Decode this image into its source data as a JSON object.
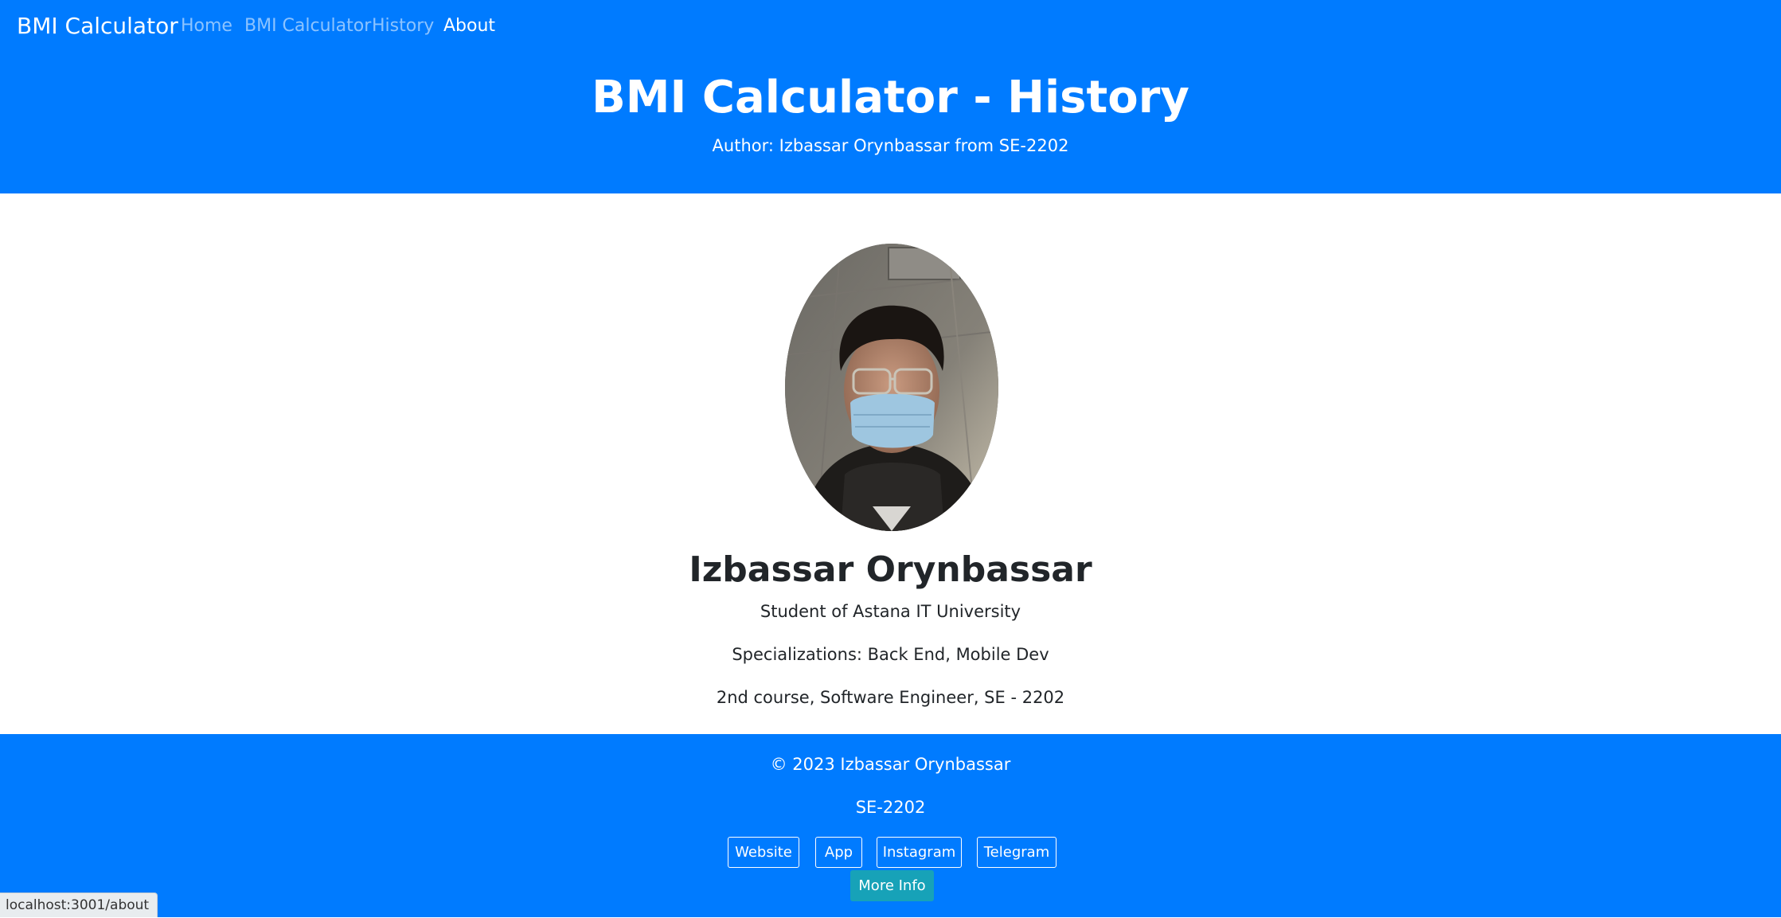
{
  "navbar": {
    "brand": "BMI Calculator",
    "links": [
      {
        "label": "Home",
        "active": false
      },
      {
        "label": "BMI Calculator",
        "active": false
      },
      {
        "label": "History",
        "active": false
      },
      {
        "label": "About",
        "active": true
      }
    ]
  },
  "hero": {
    "title": "BMI Calculator - History",
    "subtitle": "Author: Izbassar Orynbassar from SE-2202"
  },
  "profile": {
    "name": "Izbassar Orynbassar",
    "lines": [
      "Student of Astana IT University",
      "Specializations: Back End, Mobile Dev",
      "2nd course, Software Engineer, SE - 2202"
    ]
  },
  "footer": {
    "copyright": "© 2023 Izbassar Orynbassar",
    "group": "SE-2202",
    "buttons": [
      "Website",
      "App",
      "Instagram",
      "Telegram"
    ],
    "more_info": "More Info"
  },
  "status_bar": {
    "url": "localhost:3001/about"
  },
  "colors": {
    "primary": "#007bff",
    "info": "#17a2b8",
    "text": "#212529"
  }
}
